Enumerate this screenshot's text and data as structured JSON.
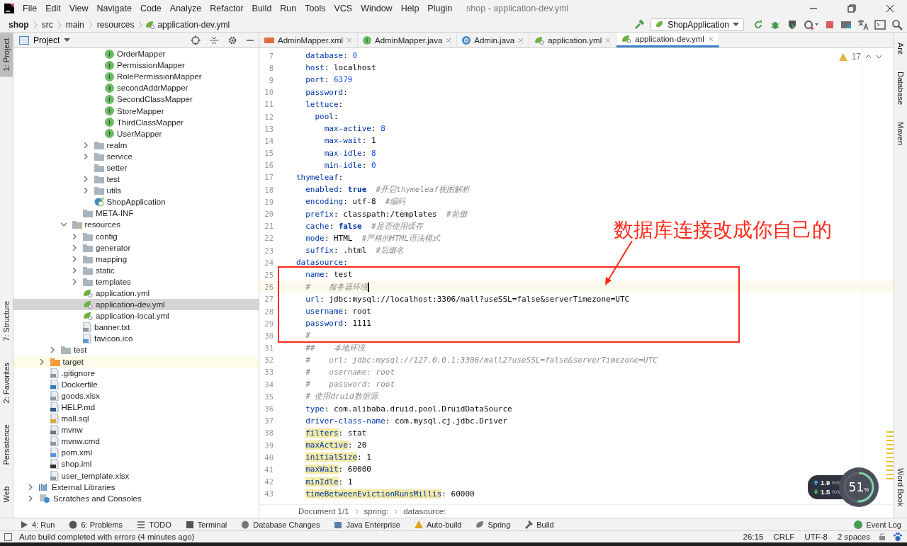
{
  "window": {
    "title": "shop - application-dev.yml"
  },
  "menu": [
    "File",
    "Edit",
    "View",
    "Navigate",
    "Code",
    "Analyze",
    "Refactor",
    "Build",
    "Run",
    "Tools",
    "VCS",
    "Window",
    "Help",
    "Plugin"
  ],
  "breadcrumb": [
    "shop",
    "src",
    "main",
    "resources",
    "application-dev.yml"
  ],
  "run_config": "ShopApplication",
  "left_stripe": [
    {
      "label": "1: Project",
      "selected": true
    },
    {
      "label": "7: Structure",
      "selected": false
    },
    {
      "label": "2: Favorites",
      "selected": false
    },
    {
      "label": "Persistence",
      "selected": false
    },
    {
      "label": "Web",
      "selected": false
    }
  ],
  "right_stripe": [
    {
      "label": "Ant"
    },
    {
      "label": "Database"
    },
    {
      "label": "Maven"
    },
    {
      "label": "Word Book"
    }
  ],
  "project_panel": {
    "title": "Project",
    "tree": [
      {
        "children": [
          {
            "children": [
              {
                "children": [
                  {
                    "children": [
                      {
                        "children": [
                          {
                            "children": [
                              {
                                "label": "OrderMapper",
                                "kind": "interface",
                                "selected": false
                              },
                              {
                                "label": "PermissionMapper",
                                "kind": "interface",
                                "selected": false
                              },
                              {
                                "label": "RolePermissionMapper",
                                "kind": "interface",
                                "selected": false
                              },
                              {
                                "label": "secondAddrMapper",
                                "kind": "interface",
                                "selected": false
                              },
                              {
                                "label": "SecondClassMapper",
                                "kind": "interface",
                                "selected": false
                              },
                              {
                                "label": "StoreMapper",
                                "kind": "interface",
                                "selected": false
                              },
                              {
                                "label": "ThirdClassMapper",
                                "kind": "interface",
                                "selected": false
                              },
                              {
                                "label": "UserMapper",
                                "kind": "interface",
                                "selected": false
                              }
                            ]
                          },
                          {
                            "label": "realm",
                            "kind": "folder",
                            "expanded": false,
                            "selected": false
                          },
                          {
                            "label": "service",
                            "kind": "folder",
                            "expanded": false,
                            "selected": false
                          },
                          {
                            "label": "setter",
                            "kind": "empty-folder",
                            "selected": false
                          },
                          {
                            "label": "test",
                            "kind": "folder",
                            "expanded": false,
                            "selected": false
                          },
                          {
                            "label": "utils",
                            "kind": "folder",
                            "expanded": false,
                            "selected": false
                          },
                          {
                            "label": "ShopApplication",
                            "kind": "spring-class",
                            "selected": false
                          }
                        ]
                      },
                      {
                        "label": "META-INF",
                        "kind": "empty-folder",
                        "selected": false
                      }
                    ]
                  },
                  {
                    "label": "resources",
                    "kind": "resources",
                    "expanded": true,
                    "selected": false,
                    "children": [
                      {
                        "label": "config",
                        "kind": "folder",
                        "expanded": false,
                        "selected": false
                      },
                      {
                        "label": "generator",
                        "kind": "folder",
                        "expanded": false,
                        "selected": false
                      },
                      {
                        "label": "mapping",
                        "kind": "folder",
                        "expanded": false,
                        "selected": false
                      },
                      {
                        "label": "static",
                        "kind": "folder",
                        "expanded": false,
                        "selected": false
                      },
                      {
                        "label": "templates",
                        "kind": "folder",
                        "expanded": false,
                        "selected": false
                      },
                      {
                        "label": "application.yml",
                        "kind": "yml",
                        "selected": false
                      },
                      {
                        "label": "application-dev.yml",
                        "kind": "yml",
                        "selected": true
                      },
                      {
                        "label": "application-local.yml",
                        "kind": "yml",
                        "selected": false
                      },
                      {
                        "label": "banner.txt",
                        "kind": "text",
                        "selected": false
                      },
                      {
                        "label": "favicon.ico",
                        "kind": "image",
                        "selected": false
                      }
                    ]
                  }
                ]
              },
              {
                "label": "test",
                "kind": "folder",
                "expanded": false,
                "selected": false
              }
            ]
          },
          {
            "label": "target",
            "kind": "excluded-folder",
            "expanded": false,
            "selected": false
          },
          {
            "label": ".gitignore",
            "kind": "ignore",
            "selected": false
          },
          {
            "label": "Dockerfile",
            "kind": "docker",
            "selected": false
          },
          {
            "label": "goods.xlsx",
            "kind": "unknown",
            "selected": false
          },
          {
            "label": "HELP.md",
            "kind": "markdown",
            "selected": false
          },
          {
            "label": "mall.sql",
            "kind": "sql",
            "selected": false
          },
          {
            "label": "mvnw",
            "kind": "script",
            "selected": false
          },
          {
            "label": "mvnw.cmd",
            "kind": "text",
            "selected": false
          },
          {
            "label": "pom.xml",
            "kind": "maven",
            "selected": false
          },
          {
            "label": "shop.iml",
            "kind": "iml",
            "selected": false
          },
          {
            "label": "user_template.xlsx",
            "kind": "unknown",
            "selected": false
          }
        ]
      },
      {
        "label": "External Libraries",
        "kind": "libraries",
        "expanded": false,
        "selected": false
      },
      {
        "label": "Scratches and Consoles",
        "kind": "scratches",
        "expanded": false,
        "selected": false
      }
    ]
  },
  "tabs": [
    {
      "label": "AdminMapper.xml",
      "kind": "xml",
      "selected": false
    },
    {
      "label": "AdminMapper.java",
      "kind": "interface",
      "selected": false
    },
    {
      "label": "Admin.java",
      "kind": "class",
      "selected": false
    },
    {
      "label": "application.yml",
      "kind": "yml",
      "selected": false
    },
    {
      "label": "application-dev.yml",
      "kind": "yml",
      "selected": true
    }
  ],
  "editor": {
    "warnings": "17",
    "lines": [
      {
        "children": [
          {
            "number": "7",
            "current": false,
            "tokens": [
              {
                "kind": "key",
                "text": "database"
              },
              {
                "kind": "plain",
                "text": ": "
              },
              {
                "kind": "num",
                "text": "0"
              }
            ]
          },
          {
            "number": "8",
            "current": false,
            "tokens": [
              {
                "kind": "key",
                "text": "host"
              },
              {
                "kind": "plain",
                "text": ": localhost"
              }
            ]
          },
          {
            "number": "9",
            "current": false,
            "tokens": [
              {
                "kind": "key",
                "text": "port"
              },
              {
                "kind": "plain",
                "text": ": "
              },
              {
                "kind": "num",
                "text": "6379"
              }
            ]
          },
          {
            "number": "10",
            "current": false,
            "tokens": [
              {
                "kind": "key",
                "text": "password"
              },
              {
                "kind": "plain",
                "text": ":"
              }
            ]
          },
          {
            "number": "11",
            "current": false,
            "tokens": [
              {
                "kind": "key",
                "text": "lettuce"
              },
              {
                "kind": "plain",
                "text": ":"
              }
            ],
            "children": [
              {
                "number": "12",
                "current": false,
                "tokens": [
                  {
                    "kind": "key",
                    "text": "pool"
                  },
                  {
                    "kind": "plain",
                    "text": ":"
                  }
                ],
                "children": [
                  {
                    "number": "13",
                    "current": false,
                    "tokens": [
                      {
                        "kind": "key",
                        "text": "max-active"
                      },
                      {
                        "kind": "plain",
                        "text": ": "
                      },
                      {
                        "kind": "num",
                        "text": "8"
                      }
                    ]
                  },
                  {
                    "number": "14",
                    "current": false,
                    "tokens": [
                      {
                        "kind": "key",
                        "text": "max-wait"
                      },
                      {
                        "kind": "plain",
                        "text": ": 1"
                      }
                    ]
                  },
                  {
                    "number": "15",
                    "current": false,
                    "tokens": [
                      {
                        "kind": "key",
                        "text": "max-idle"
                      },
                      {
                        "kind": "plain",
                        "text": ": "
                      },
                      {
                        "kind": "num",
                        "text": "8"
                      }
                    ]
                  },
                  {
                    "number": "16",
                    "current": false,
                    "tokens": [
                      {
                        "kind": "key",
                        "text": "min-idle"
                      },
                      {
                        "kind": "plain",
                        "text": ": "
                      },
                      {
                        "kind": "num",
                        "text": "0"
                      }
                    ]
                  }
                ]
              }
            ]
          }
        ]
      },
      {
        "number": "17",
        "current": false,
        "tokens": [
          {
            "kind": "key",
            "text": "thymeleaf"
          },
          {
            "kind": "plain",
            "text": ":"
          }
        ],
        "children": [
          {
            "number": "18",
            "current": false,
            "tokens": [
              {
                "kind": "key",
                "text": "enabled"
              },
              {
                "kind": "plain",
                "text": ": "
              },
              {
                "kind": "bool",
                "text": "true"
              },
              {
                "kind": "comment",
                "text": "#开启thymeleaf视图解析"
              }
            ]
          },
          {
            "number": "19",
            "current": false,
            "tokens": [
              {
                "kind": "key",
                "text": "encoding"
              },
              {
                "kind": "plain",
                "text": ": utf-8"
              },
              {
                "kind": "comment",
                "text": "#编码"
              }
            ]
          },
          {
            "number": "20",
            "current": false,
            "tokens": [
              {
                "kind": "key",
                "text": "prefix"
              },
              {
                "kind": "plain",
                "text": ": classpath:/templates"
              },
              {
                "kind": "comment",
                "text": "#前缀"
              }
            ]
          },
          {
            "number": "21",
            "current": false,
            "tokens": [
              {
                "kind": "key",
                "text": "cache"
              },
              {
                "kind": "plain",
                "text": ": "
              },
              {
                "kind": "bool",
                "text": "false"
              },
              {
                "kind": "comment",
                "text": "#是否使用缓存"
              }
            ]
          },
          {
            "number": "22",
            "current": false,
            "tokens": [
              {
                "kind": "key",
                "text": "mode"
              },
              {
                "kind": "plain",
                "text": ": HTML"
              },
              {
                "kind": "comment",
                "text": "#严格的HTML语法模式"
              }
            ]
          },
          {
            "number": "23",
            "current": false,
            "tokens": [
              {
                "kind": "key",
                "text": "suffix"
              },
              {
                "kind": "plain",
                "text": ": .html"
              },
              {
                "kind": "comment",
                "text": "#后缀名"
              }
            ]
          }
        ]
      },
      {
        "number": "24",
        "current": false,
        "tokens": [
          {
            "kind": "key",
            "text": "datasource"
          },
          {
            "kind": "plain",
            "text": ":"
          }
        ],
        "children": [
          {
            "number": "25",
            "current": false,
            "tokens": [
              {
                "kind": "key",
                "text": "name"
              },
              {
                "kind": "plain",
                "text": ": test"
              }
            ]
          },
          {
            "number": "26",
            "current": true,
            "tokens": [
              {
                "kind": "comment",
                "text": "#    服务器环境"
              }
            ]
          },
          {
            "number": "27",
            "current": false,
            "tokens": [
              {
                "kind": "key",
                "text": "url"
              },
              {
                "kind": "plain",
                "text": ": jdbc:mysql://localhost:3306/mall?useSSL=false&serverTimezone=UTC"
              }
            ]
          },
          {
            "number": "28",
            "current": false,
            "tokens": [
              {
                "kind": "key",
                "text": "username"
              },
              {
                "kind": "plain",
                "text": ": root"
              }
            ]
          },
          {
            "number": "29",
            "current": false,
            "tokens": [
              {
                "kind": "key",
                "text": "password"
              },
              {
                "kind": "plain",
                "text": ": 1111"
              }
            ]
          },
          {
            "number": "30",
            "current": false,
            "tokens": [
              {
                "kind": "comment",
                "text": "#"
              }
            ]
          },
          {
            "number": "31",
            "current": false,
            "tokens": [
              {
                "kind": "comment",
                "text": "##    本地环境"
              }
            ]
          },
          {
            "number": "32",
            "current": false,
            "tokens": [
              {
                "kind": "comment",
                "text": "#    url: jdbc:mysql://127.0.0.1:3306/mall2?useSSL=false&serverTimezone=UTC"
              }
            ]
          },
          {
            "number": "33",
            "current": false,
            "tokens": [
              {
                "kind": "comment",
                "text": "#    username: root"
              }
            ]
          },
          {
            "number": "34",
            "current": false,
            "tokens": [
              {
                "kind": "comment",
                "text": "#    password: root"
              }
            ]
          },
          {
            "number": "35",
            "current": false,
            "tokens": [
              {
                "kind": "comment",
                "text": "# 使用druid数据源"
              }
            ]
          },
          {
            "number": "36",
            "current": false,
            "tokens": [
              {
                "kind": "key",
                "text": "type"
              },
              {
                "kind": "plain",
                "text": ": com.alibaba.druid.pool.DruidDataSource"
              }
            ]
          },
          {
            "number": "37",
            "current": false,
            "tokens": [
              {
                "kind": "key",
                "text": "driver-class-name"
              },
              {
                "kind": "plain",
                "text": ": com.mysql.cj.jdbc.Driver"
              }
            ]
          },
          {
            "number": "38",
            "current": false,
            "tokens": [
              {
                "kind": "warnkey",
                "text": "filters"
              },
              {
                "kind": "plain",
                "text": ": stat"
              }
            ]
          },
          {
            "number": "39",
            "current": false,
            "tokens": [
              {
                "kind": "warnkey",
                "text": "maxActive"
              },
              {
                "kind": "plain",
                "text": ": 20"
              }
            ]
          },
          {
            "number": "40",
            "current": false,
            "tokens": [
              {
                "kind": "warnkey",
                "text": "initialSize"
              },
              {
                "kind": "plain",
                "text": ": 1"
              }
            ]
          },
          {
            "number": "41",
            "current": false,
            "tokens": [
              {
                "kind": "warnkey",
                "text": "maxWait"
              },
              {
                "kind": "plain",
                "text": ": 60000"
              }
            ]
          },
          {
            "number": "42",
            "current": false,
            "tokens": [
              {
                "kind": "warnkey",
                "text": "minIdle"
              },
              {
                "kind": "plain",
                "text": ": 1"
              }
            ]
          },
          {
            "number": "43",
            "current": false,
            "tokens": [
              {
                "kind": "warnkey",
                "text": "timeBetweenEvictionRunsMillis"
              },
              {
                "kind": "plain",
                "text": ": 60000"
              }
            ]
          }
        ]
      }
    ],
    "path": [
      "Document 1/1",
      "spring:",
      "datasource:"
    ]
  },
  "annotation": {
    "text": "数据库连接改成你自己的"
  },
  "tool_windows": [
    {
      "label": "4: Run",
      "kind": "run"
    },
    {
      "label": "6: Problems",
      "kind": "problems"
    },
    {
      "label": "TODO",
      "kind": "todo"
    },
    {
      "label": "Terminal",
      "kind": "terminal"
    },
    {
      "label": "Database Changes",
      "kind": "database"
    },
    {
      "label": "Java Enterprise",
      "kind": "enterprise"
    },
    {
      "label": "Auto-build",
      "kind": "warning"
    },
    {
      "label": "Spring",
      "kind": "spring"
    },
    {
      "label": "Build",
      "kind": "build"
    }
  ],
  "event_log": "Event Log",
  "status_bar": {
    "message": "Auto build completed with errors (4 minutes ago)",
    "position": "26:15",
    "line_separator": "CRLF",
    "encoding": "UTF-8",
    "indent": "2 spaces"
  },
  "net_monitor": {
    "upload": "1.9",
    "upload_unit": "K/s",
    "download": "1.5",
    "download_unit": "K/s",
    "percent": "51",
    "percent_sign": "%",
    "level": 0.51
  }
}
